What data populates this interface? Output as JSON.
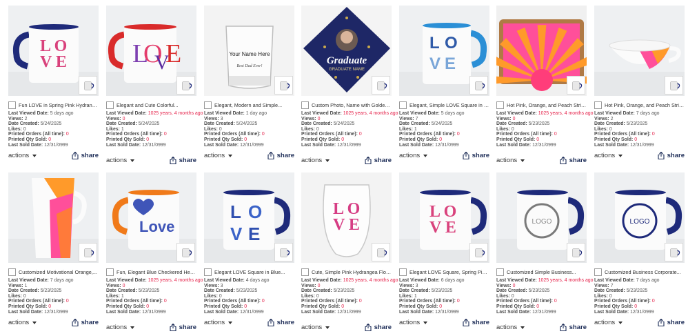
{
  "labels": {
    "last_viewed": "Last Viewed Date:",
    "views": "Views:",
    "date_created": "Date Created:",
    "likes": "Likes:",
    "printed_orders": "Printed Orders (All time):",
    "printed_qty": "Printed Qty Sold:",
    "last_sold": "Last Sold Date:",
    "actions": "actions",
    "share": "share"
  },
  "colors": {
    "accent_red": "#e5224a",
    "share_navy": "#1a2a55"
  },
  "products": [
    {
      "title": "Fun LOVE in Spring Pink Hydrange...",
      "last_viewed": "5 days ago",
      "views": "2",
      "created": "5/24/2025",
      "likes": "0",
      "orders": "0",
      "qty": "0",
      "last_sold": "12/31/0999",
      "image": "pink-love-mug-blue-handle",
      "stale": false
    },
    {
      "title": "Elegant and Cute Colorful...",
      "last_viewed": "1025 years, 4 months ago",
      "views": "0",
      "created": "5/24/2025",
      "likes": "1",
      "orders": "0",
      "qty": "0",
      "last_sold": "12/31/0999",
      "image": "colorful-love-mug-red-handle",
      "stale": true
    },
    {
      "title": "Elegant, Modern and Simple...",
      "last_viewed": "1 day ago",
      "views": "3",
      "created": "5/24/2025",
      "likes": "0",
      "orders": "0",
      "qty": "0",
      "last_sold": "12/31/0999",
      "image": "whiskey-glass-name",
      "stale": false
    },
    {
      "title": "Custom Photo, Name with Golden...",
      "last_viewed": "1025 years, 4 months ago",
      "views": "0",
      "created": "5/24/2025",
      "likes": "0",
      "orders": "0",
      "qty": "0",
      "last_sold": "12/31/0999",
      "image": "graduate-cap-topper",
      "stale": true
    },
    {
      "title": "Elegant, Simple LOVE Square in Bl...",
      "last_viewed": "5 days ago",
      "views": "7",
      "created": "5/24/2025",
      "likes": "1",
      "orders": "0",
      "qty": "0",
      "last_sold": "12/31/0999",
      "image": "blue-love-square-mug",
      "stale": false
    },
    {
      "title": "Hot Pink, Orange, and Peach Stripe...",
      "last_viewed": "1025 years, 4 months ago",
      "views": "0",
      "created": "5/23/2025",
      "likes": "0",
      "orders": "0",
      "qty": "0",
      "last_sold": "12/31/0999",
      "image": "sunburst-tray",
      "stale": true
    },
    {
      "title": "Hot Pink, Orange, and Peach Stripe...",
      "last_viewed": "7 days ago",
      "views": "2",
      "created": "5/23/2025",
      "likes": "0",
      "orders": "0",
      "qty": "0",
      "last_sold": "12/31/0999",
      "image": "striped-soup-mug",
      "stale": false
    },
    {
      "title": "Customized Motivational Orange,...",
      "last_viewed": "7 days ago",
      "views": "1",
      "created": "5/23/2025",
      "likes": "0",
      "orders": "0",
      "qty": "0",
      "last_sold": "12/31/0999",
      "image": "orange-latte-mug",
      "stale": false
    },
    {
      "title": "Fun, Elegant Blue Checkered Heart...",
      "last_viewed": "1025 years, 4 months ago",
      "views": "0",
      "created": "5/23/2025",
      "likes": "1",
      "orders": "0",
      "qty": "0",
      "last_sold": "12/31/0999",
      "image": "checkered-heart-love-mug",
      "stale": true
    },
    {
      "title": "Elegant LOVE Square in Blue...",
      "last_viewed": "4 days ago",
      "views": "3",
      "created": "5/23/2025",
      "likes": "0",
      "orders": "0",
      "qty": "0",
      "last_sold": "12/31/0999",
      "image": "blue-gingham-love-mug",
      "stale": false
    },
    {
      "title": "Cute, Simple Pink Hydrangea Floral...",
      "last_viewed": "1025 years, 4 months ago",
      "views": "0",
      "created": "5/23/2025",
      "likes": "0",
      "orders": "0",
      "qty": "0",
      "last_sold": "12/31/0999",
      "image": "stemless-wine-glass-love",
      "stale": true
    },
    {
      "title": "Elegant LOVE Square, Spring Pink...",
      "last_viewed": "6 days ago",
      "views": "3",
      "created": "5/23/2025",
      "likes": "1",
      "orders": "0",
      "qty": "0",
      "last_sold": "12/31/0999",
      "image": "pink-love-square-mug",
      "stale": false
    },
    {
      "title": "Customized Simple Business...",
      "last_viewed": "1025 years, 4 months ago",
      "views": "0",
      "created": "5/23/2025",
      "likes": "0",
      "orders": "0",
      "qty": "0",
      "last_sold": "12/31/0999",
      "image": "business-logo-mug",
      "stale": true
    },
    {
      "title": "Customized Business Corporate...",
      "last_viewed": "7 days ago",
      "views": "7",
      "created": "5/23/2025",
      "likes": "0",
      "orders": "0",
      "qty": "0",
      "last_sold": "12/31/0999",
      "image": "corporate-logo-mug-navy",
      "stale": false
    }
  ]
}
